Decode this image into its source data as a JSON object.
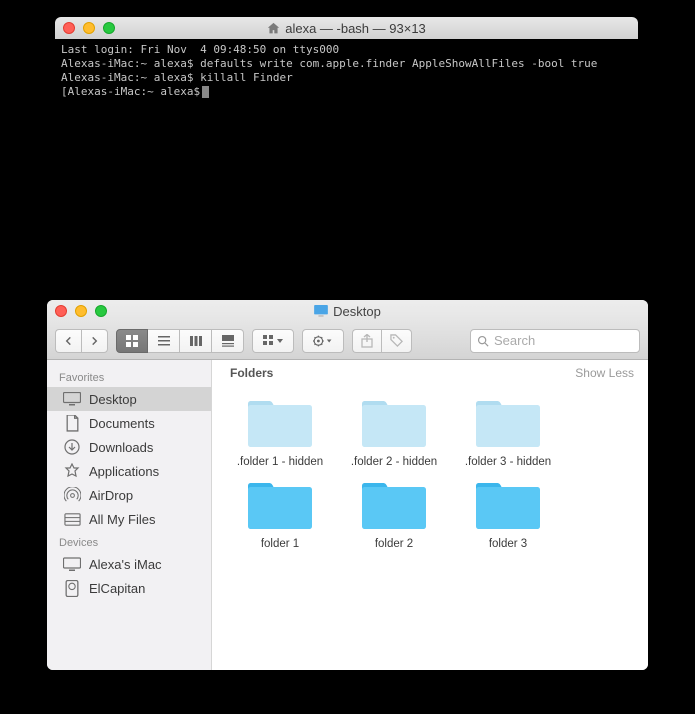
{
  "terminal": {
    "title": "alexa — -bash — 93×13",
    "lines": [
      "Last login: Fri Nov  4 09:48:50 on ttys000",
      "Alexas-iMac:~ alexa$ defaults write com.apple.finder AppleShowAllFiles -bool true",
      "Alexas-iMac:~ alexa$ killall Finder",
      "[Alexas-iMac:~ alexa$"
    ]
  },
  "finder": {
    "title": "Desktop",
    "search_placeholder": "Search",
    "sidebar": {
      "favorites_heading": "Favorites",
      "devices_heading": "Devices",
      "favorites": [
        {
          "label": "Desktop",
          "icon": "desktop",
          "selected": true
        },
        {
          "label": "Documents",
          "icon": "documents",
          "selected": false
        },
        {
          "label": "Downloads",
          "icon": "downloads",
          "selected": false
        },
        {
          "label": "Applications",
          "icon": "applications",
          "selected": false
        },
        {
          "label": "AirDrop",
          "icon": "airdrop",
          "selected": false
        },
        {
          "label": "All My Files",
          "icon": "allmyfiles",
          "selected": false
        }
      ],
      "devices": [
        {
          "label": "Alexa's iMac",
          "icon": "imac"
        },
        {
          "label": "ElCapitan",
          "icon": "disk"
        }
      ]
    },
    "content": {
      "section_title": "Folders",
      "toggle_label": "Show Less",
      "items": [
        {
          "label": ".folder 1 - hidden",
          "hidden": true
        },
        {
          "label": ".folder 2 - hidden",
          "hidden": true
        },
        {
          "label": ".folder 3 - hidden",
          "hidden": true
        },
        {
          "label": "folder 1",
          "hidden": false
        },
        {
          "label": "folder 2",
          "hidden": false
        },
        {
          "label": "folder 3",
          "hidden": false
        }
      ]
    }
  }
}
